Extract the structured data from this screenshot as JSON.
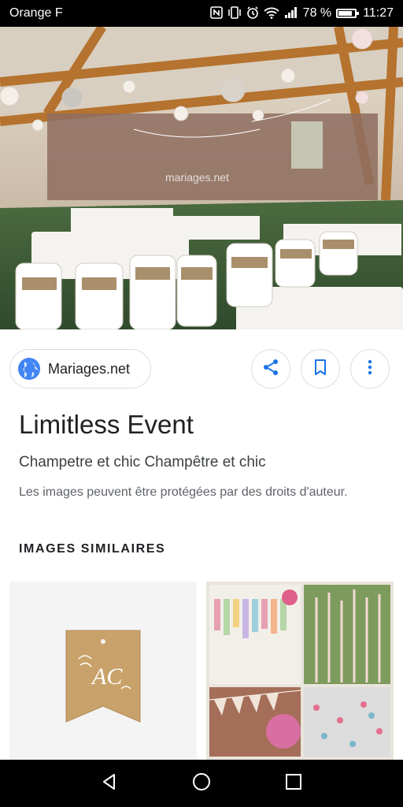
{
  "status_bar": {
    "carrier": "Orange F",
    "battery_text": "78 %",
    "battery_level": 0.78,
    "time": "11:27",
    "icons": [
      "nfc-icon",
      "vibrate-icon",
      "alarm-icon",
      "wifi-icon",
      "signal-icon",
      "battery-icon"
    ]
  },
  "hero": {
    "watermark": "mariages.net"
  },
  "source": {
    "name": "Mariages.net",
    "icon": "globe-icon"
  },
  "actions": {
    "share_icon": "share-icon",
    "save_icon": "bookmark-icon",
    "more_icon": "more-vert-icon"
  },
  "result": {
    "title": "Limitless Event",
    "subtitle": "Champetre et chic Champêtre et chic",
    "copyright": "Les images peuvent être protégées par des droits d'auteur."
  },
  "similar": {
    "heading": "IMAGES SIMILAIRES",
    "tag_monogram": "AC"
  },
  "colors": {
    "accent": "#1a73e8",
    "chip_border": "#dadce0"
  }
}
